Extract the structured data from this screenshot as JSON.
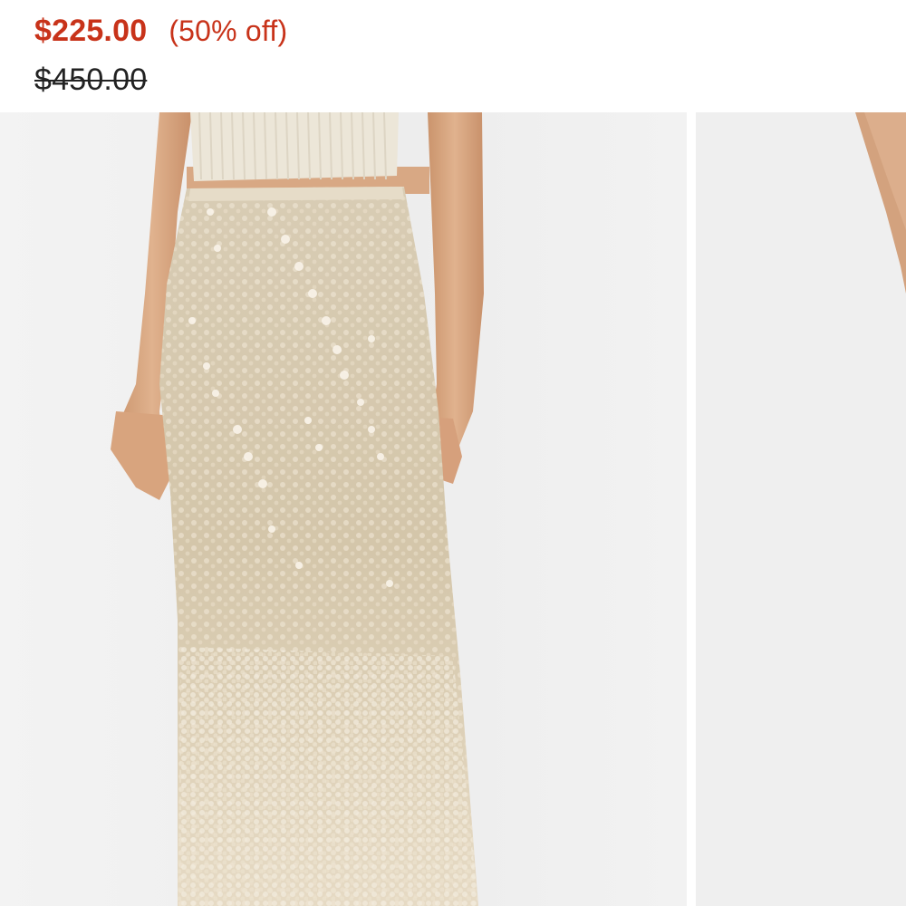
{
  "product": {
    "sale_price": "$225.00",
    "discount_label": "(50% off)",
    "original_price": "$450.00"
  },
  "colors": {
    "sale": "#c8331a",
    "original": "#222222",
    "discount": "#c8331a",
    "photo_bg": "#efefef",
    "skirt": "#d9ccb2",
    "skin": "#d9a882",
    "top": "#ece6d8"
  },
  "gallery": {
    "images": [
      {
        "name": "Sequin maxi skirt - front view"
      },
      {
        "name": "Sequin maxi skirt - side view"
      }
    ]
  }
}
